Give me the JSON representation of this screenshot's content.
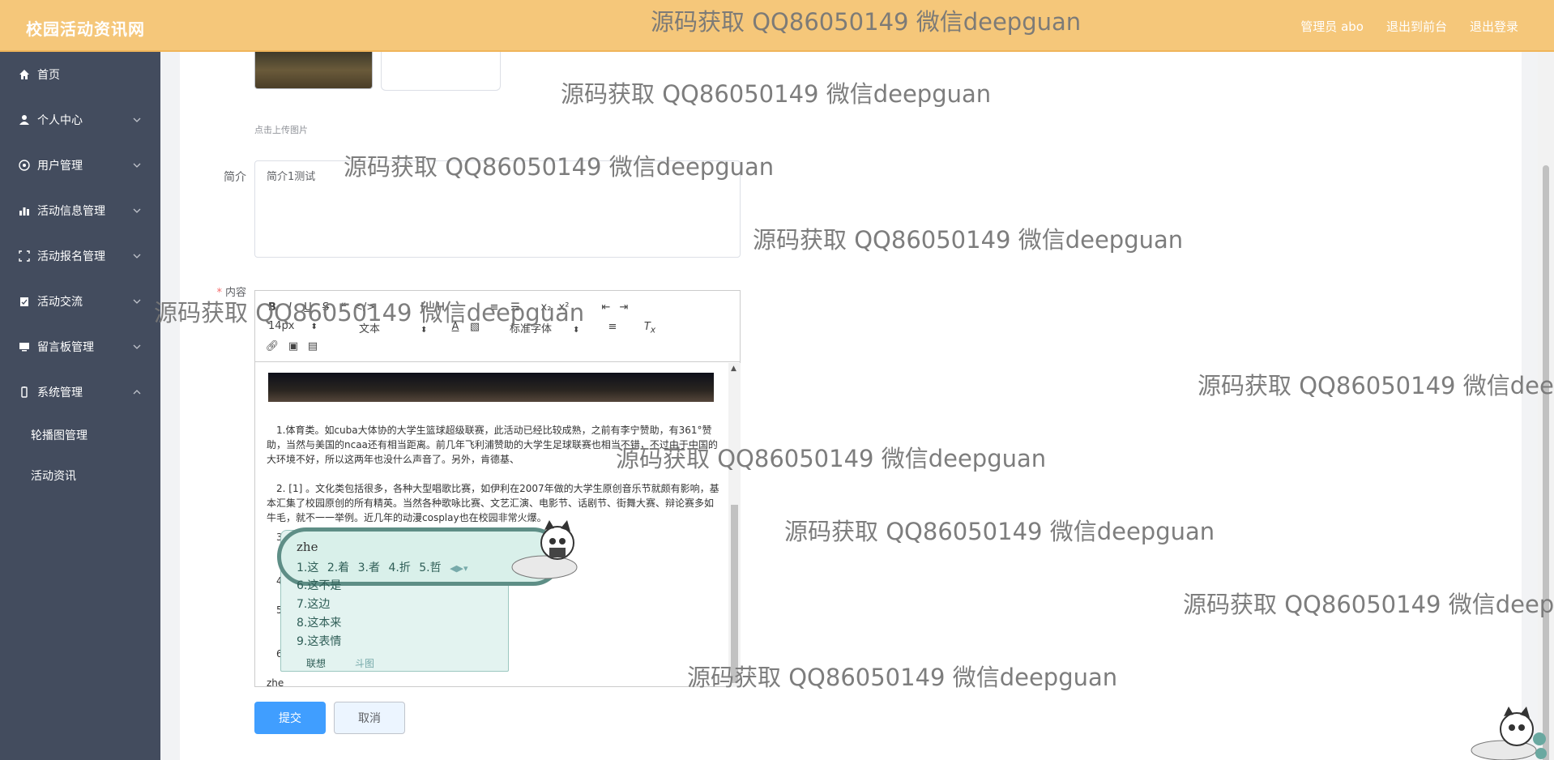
{
  "header": {
    "brand": "校园活动资讯网",
    "user": "管理员 abo",
    "back_to_front": "退出到前台",
    "logout": "退出登录"
  },
  "sidebar": {
    "items": [
      {
        "label": "首页",
        "icon": "home-icon"
      },
      {
        "label": "个人中心",
        "icon": "user-icon"
      },
      {
        "label": "用户管理",
        "icon": "users-icon"
      },
      {
        "label": "活动信息管理",
        "icon": "chart-icon"
      },
      {
        "label": "活动报名管理",
        "icon": "frame-icon"
      },
      {
        "label": "活动交流",
        "icon": "clipboard-icon"
      },
      {
        "label": "留言板管理",
        "icon": "monitor-icon"
      },
      {
        "label": "系统管理",
        "icon": "battery-icon"
      }
    ],
    "sub_items": [
      "轮播图管理",
      "活动资讯"
    ]
  },
  "form": {
    "upload_tip": "点击上传图片",
    "intro_label": "简介",
    "intro_value": "简介1测试",
    "content_label": "内容",
    "submit": "提交",
    "cancel": "取消"
  },
  "editor": {
    "font_size": "14px",
    "format": "文本",
    "font_family": "标准字体",
    "paragraphs": [
      "1.体育类。如cuba大体协的大学生篮球超级联赛，此活动已经比较成熟，之前有李宁赞助，有361°赞助，当然与美国的ncaa还有相当距离。前几年飞利浦赞助的大学生足球联赛也相当不错，不过由于中国的大环境不好，所以这两年也没什么声音了。另外，肯德基、",
      "2. [1] 。文化类包括很多，各种大型唱歌比赛，如伊利在2007年做的大学生原创音乐节就颇有影响，基本汇集了校园原创的所有精英。当然各种歌咏比赛、文艺汇演、电影节、话剧节、街舞大赛、辩论赛多如牛毛，就不一一举例。近几年的动漫cosplay也在校园非常火爆。",
      "3.",
      "4.",
      "5.",
      "6."
    ],
    "typed": "zhe"
  },
  "ime": {
    "composition": "zhe",
    "row": [
      "1.这",
      "2.着",
      "3.者",
      "4.折",
      "5.哲"
    ],
    "candidates": [
      "6.这不是",
      "7.这边",
      "8.这本来",
      "9.这表情"
    ],
    "tabs": [
      "联想",
      "斗图"
    ]
  },
  "watermark": "源码获取 QQ86050149 微信deepguan"
}
